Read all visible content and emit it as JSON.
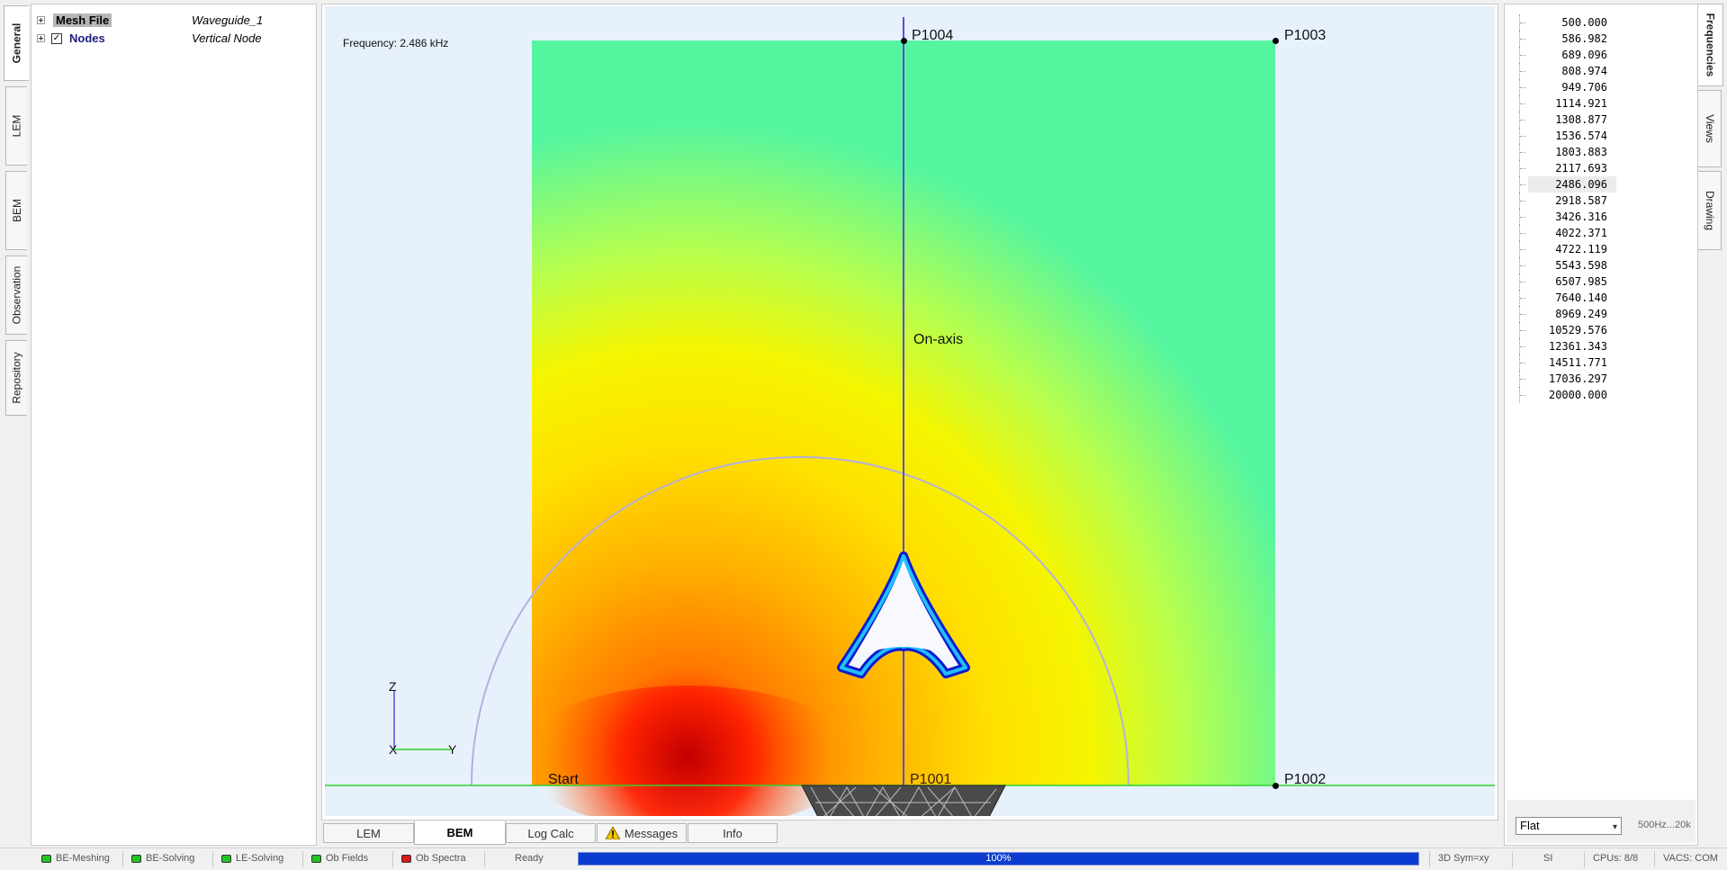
{
  "left_tabs": [
    "General",
    "LEM",
    "BEM",
    "Observation",
    "Repository"
  ],
  "tree": [
    {
      "key": "Mesh File",
      "value": "Waveguide_1"
    },
    {
      "key": "Nodes",
      "value": "Vertical Node"
    }
  ],
  "view": {
    "frequency_label": "Frequency: 2.486 kHz",
    "nodes": {
      "p1004": "P1004",
      "p1003": "P1003",
      "p1002": "P1002",
      "p1001": "P1001"
    },
    "start_label": "Start",
    "on_axis_label": "On-axis",
    "axes": {
      "z": "Z",
      "x": "X",
      "y": "Y"
    },
    "colors": {
      "line": "#5c4be0",
      "ground": "#30d030",
      "arc": "#b5b0dc"
    }
  },
  "bottom_tabs": [
    "LEM",
    "BEM",
    "Log Calc",
    "Messages",
    "Info"
  ],
  "frequencies": [
    "500.000",
    "586.982",
    "689.096",
    "808.974",
    "949.706",
    "1114.921",
    "1308.877",
    "1536.574",
    "1803.883",
    "2117.693",
    "2486.096",
    "2918.587",
    "3426.316",
    "4022.371",
    "4722.119",
    "5543.598",
    "6507.985",
    "7640.140",
    "8969.249",
    "10529.576",
    "12361.343",
    "14511.771",
    "17036.297",
    "20000.000"
  ],
  "selected_frequency": "2486.096",
  "right_controls": {
    "select_value": "Flat",
    "range_label": "500Hz...20k"
  },
  "right_tabs": [
    "Frequencies",
    "Views",
    "Drawing"
  ],
  "status": {
    "leds": [
      {
        "label": "BE-Meshing",
        "color": "#21c521"
      },
      {
        "label": "BE-Solving",
        "color": "#21c521"
      },
      {
        "label": "LE-Solving",
        "color": "#21c521"
      },
      {
        "label": "Ob Fields",
        "color": "#21c521"
      },
      {
        "label": "Ob Spectra",
        "color": "#d91a1a"
      }
    ],
    "ready": "Ready",
    "progress": "100%",
    "progress_value": 1.0,
    "sym": "3D Sym=xy",
    "units": "SI",
    "cpus": "CPUs: 8/8",
    "vacs": "VACS: COM"
  }
}
